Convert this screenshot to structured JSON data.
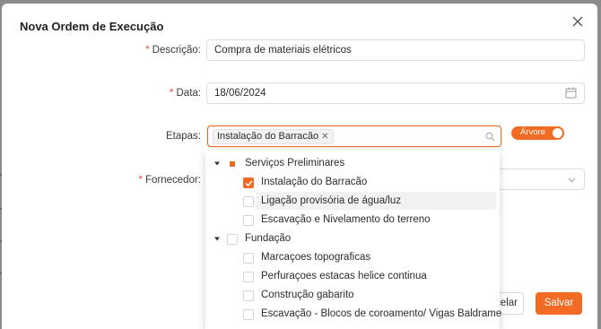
{
  "modal": {
    "title": "Nova Ordem de Execução"
  },
  "form": {
    "descricao": {
      "label": "Descrição",
      "value": "Compra de materiais elétricos"
    },
    "data": {
      "label": "Data",
      "value": "18/06/2024"
    },
    "etapas": {
      "label": "Etapas",
      "selected_tag": "Instalação do Barracão",
      "toggle_label": "Árvore"
    },
    "fornecedor": {
      "label": "Fornecedor"
    },
    "required_mark": "*",
    "separator": ":"
  },
  "tree": [
    {
      "label": "Serviços Preliminares",
      "state": "indeterminate",
      "level": 0,
      "expanded": true
    },
    {
      "label": "Instalação do Barracão",
      "state": "checked",
      "level": 1
    },
    {
      "label": "Ligação provisória de água/luz",
      "state": "unchecked",
      "level": 1,
      "highlight": true
    },
    {
      "label": "Escavação e Nivelamento do terreno",
      "state": "unchecked",
      "level": 1
    },
    {
      "label": "Fundação",
      "state": "unchecked",
      "level": 0,
      "expanded": true
    },
    {
      "label": "Marcaçoes topograficas",
      "state": "unchecked",
      "level": 1
    },
    {
      "label": "Perfuraçoes estacas helice continua",
      "state": "unchecked",
      "level": 1
    },
    {
      "label": "Construção gabarito",
      "state": "unchecked",
      "level": 1
    },
    {
      "label": "Escavação - Blocos de coroamento/ Vigas Baldrame",
      "state": "unchecked",
      "level": 1
    }
  ],
  "footer": {
    "cancel_label": "celar",
    "save_label": "Salvar"
  },
  "colors": {
    "accent": "#f26b24",
    "required": "#e94b35"
  }
}
